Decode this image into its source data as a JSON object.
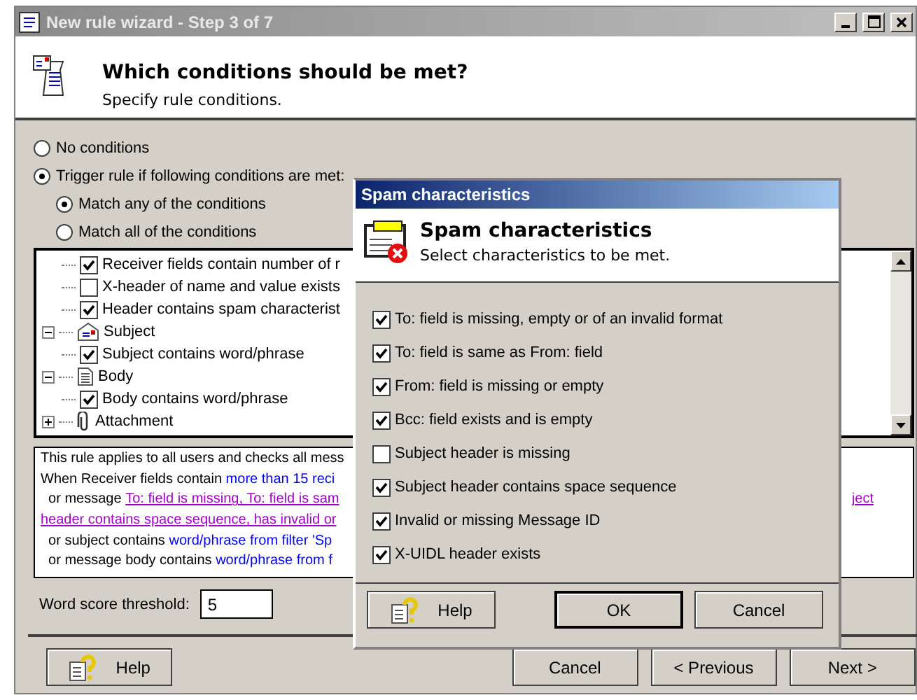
{
  "window": {
    "title": "New rule wizard - Step 3 of 7"
  },
  "header": {
    "title": "Which conditions should be met?",
    "subtitle": "Specify rule conditions."
  },
  "options": [
    {
      "label": "No conditions",
      "selected": false
    },
    {
      "label": "Trigger rule if following conditions are met:",
      "selected": true
    }
  ],
  "match_options": [
    {
      "label": "Match any of the conditions",
      "selected": true
    },
    {
      "label": "Match all of the conditions",
      "selected": false
    }
  ],
  "tree": [
    {
      "kind": "hidden",
      "children": [
        {
          "label": "Receiver fields contain number of r",
          "checked": true
        },
        {
          "label": "X-header of name and value exists",
          "checked": false
        },
        {
          "label": "Header contains spam characterist",
          "checked": true
        }
      ]
    },
    {
      "kind": "subject",
      "label": "Subject",
      "expanded": true,
      "children": [
        {
          "label": "Subject contains word/phrase",
          "checked": true
        }
      ]
    },
    {
      "kind": "body",
      "label": "Body",
      "expanded": true,
      "children": [
        {
          "label": "Body contains word/phrase",
          "checked": true
        }
      ]
    },
    {
      "kind": "attachment",
      "label": "Attachment",
      "expanded": false
    }
  ],
  "description": [
    {
      "left": [
        {
          "text": "This rule applies to all users and checks all mess",
          "kind": "plain"
        }
      ]
    },
    {
      "left": [
        {
          "text": "When Receiver fields contain ",
          "kind": "plain"
        },
        {
          "text": "more than 15 reci",
          "kind": "link"
        }
      ]
    },
    {
      "left": [
        {
          "text": "  or message ",
          "kind": "plain"
        },
        {
          "text": "To: field is missing, To: field is sam",
          "kind": "visited"
        }
      ],
      "right": [
        {
          "text": "ject",
          "kind": "visited"
        }
      ]
    },
    {
      "left": [
        {
          "text": "header contains space sequence, has invalid or",
          "kind": "visited"
        }
      ]
    },
    {
      "left": [
        {
          "text": "  or subject contains ",
          "kind": "plain"
        },
        {
          "text": "word/phrase from filter 'Sp",
          "kind": "link"
        }
      ]
    },
    {
      "left": [
        {
          "text": "  or message body contains ",
          "kind": "plain"
        },
        {
          "text": "word/phrase from f",
          "kind": "link"
        }
      ]
    }
  ],
  "threshold": {
    "label": "Word score threshold:",
    "value": "5"
  },
  "buttons": {
    "help": "Help",
    "cancel": "Cancel",
    "previous": "< Previous",
    "next": "Next >"
  },
  "dialog": {
    "title": "Spam characteristics",
    "heading": "Spam characteristics",
    "subtitle": "Select characteristics to be met.",
    "items": [
      {
        "label": "To: field is missing, empty or of an invalid format",
        "checked": true
      },
      {
        "label": "To: field is same as From: field",
        "checked": true
      },
      {
        "label": "From: field is missing or empty",
        "checked": true
      },
      {
        "label": "Bcc: field exists and is empty",
        "checked": true
      },
      {
        "label": "Subject header is missing",
        "checked": false
      },
      {
        "label": "Subject header contains space sequence",
        "checked": true
      },
      {
        "label": "Invalid or missing Message ID",
        "checked": true
      },
      {
        "label": "X-UIDL header exists",
        "checked": true
      }
    ],
    "buttons": {
      "help": "Help",
      "ok": "OK",
      "cancel": "Cancel"
    }
  }
}
